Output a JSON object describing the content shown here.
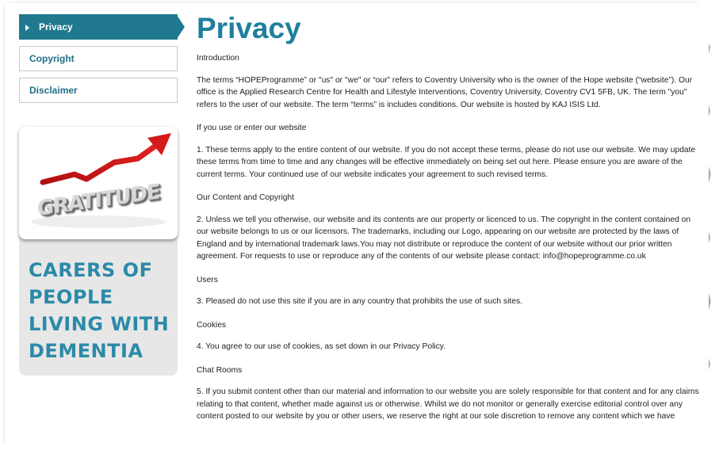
{
  "sidebar": {
    "items": [
      {
        "label": "Privacy",
        "active": true
      },
      {
        "label": "Copyright",
        "active": false
      },
      {
        "label": "Disclaimer",
        "active": false
      }
    ]
  },
  "promo": {
    "image_word": "GRATITUDE",
    "caption": "CARERS OF PEOPLE LIVING WITH DEMENTIA"
  },
  "main": {
    "title": "Privacy",
    "sections": {
      "intro_heading": "Introduction",
      "intro_text": "The terms “HOPEProgramme” or \"us\" or \"we\" or “our” refers to Coventry University who is the owner of the Hope website (“website”). Our office is the Applied Research Centre for Health and Lifestyle Interventions, Coventry University, Coventry CV1 5FB, UK. The term \"you\" refers to the user of our website.  The term “terms” is includes conditions. Our website is hosted by KAJ ISIS Ltd.",
      "use_heading": "If you use or enter our website",
      "use_text": "1. These terms apply to the entire content of our website. If you do not accept these terms, please do not use our website. We may update these terms from time to time and any changes will be effective immediately on being set out here. Please ensure you are aware of the current terms. Your continued use of our website indicates your agreement to such revised terms.",
      "content_heading": "Our Content and Copyright",
      "content_text": "2. Unless we tell you otherwise, our website and its contents are our property or licenced to us. The copyright in the content contained on our website belongs to us or our licensors. The trademarks, including our Logo, appearing on our website are protected by the laws of England and by international trademark laws.You may not distribute or reproduce the content of our website without our prior written agreement. For requests to use or reproduce any of the contents of our website please contact: info@hopeprogramme.co.uk",
      "users_heading": "Users",
      "users_text": "3. Pleased do not use this site if you are in any country that prohibits the use of such sites.",
      "cookies_heading": "Cookies",
      "cookies_text": "4. You agree to our use of cookies, as set down in our Privacy Policy.",
      "chat_heading": "Chat Rooms",
      "chat_text": "5. If you submit content other than our material and information to our website you are solely responsible for that content and for any claims relating to that content, whether made against us or otherwise. Whilst we do not monitor or generally exercise editorial control over any content posted to our website by you or other users, we reserve the right at our sole discretion to remove any content which we have"
    }
  },
  "colors": {
    "accent": "#20798f",
    "title": "#1f7f9c",
    "caption": "#2b8aa8"
  }
}
